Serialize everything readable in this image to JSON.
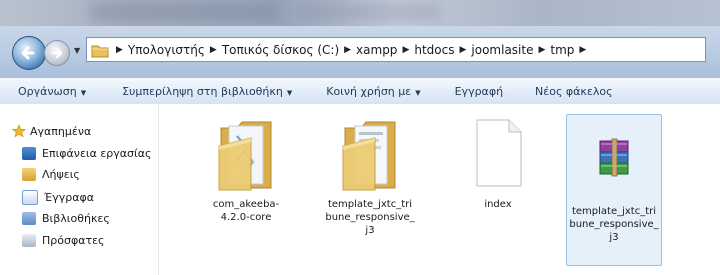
{
  "address_bar": {
    "crumbs": [
      "Υπολογιστής",
      "Τοπικός δίσκος (C:)",
      "xampp",
      "htdocs",
      "joomlasite",
      "tmp"
    ]
  },
  "toolbar": {
    "organize": "Οργάνωση",
    "library": "Συμπερίληψη στη βιβλιοθήκη",
    "share": "Κοινή χρήση με",
    "burn": "Εγγραφή",
    "new_folder": "Νέος φάκελος"
  },
  "nav": {
    "favorites": "Αγαπημένα",
    "desktop": "Επιφάνεια εργασίας",
    "downloads": "Λήψεις",
    "documents": "Έγγραφα",
    "libraries": "Βιβλιοθήκες",
    "recent": "Πρόσφατες"
  },
  "files": [
    {
      "name": "com_akeeba-4.2.0-core",
      "type": "folder",
      "icon": "folder-icon"
    },
    {
      "name": "template_jxtc_tribune_responsive_j3",
      "type": "folder",
      "icon": "folder-icon"
    },
    {
      "name": "index",
      "type": "file",
      "icon": "blank-document-icon"
    },
    {
      "name": "template_jxtc_tribune_responsive_j3",
      "type": "archive",
      "icon": "winrar-archive-icon",
      "selected": true
    }
  ],
  "colors": {
    "toolbar_text": "#1e395b",
    "selection": "#e5f0fb",
    "selection_border": "#9dc2e8"
  }
}
